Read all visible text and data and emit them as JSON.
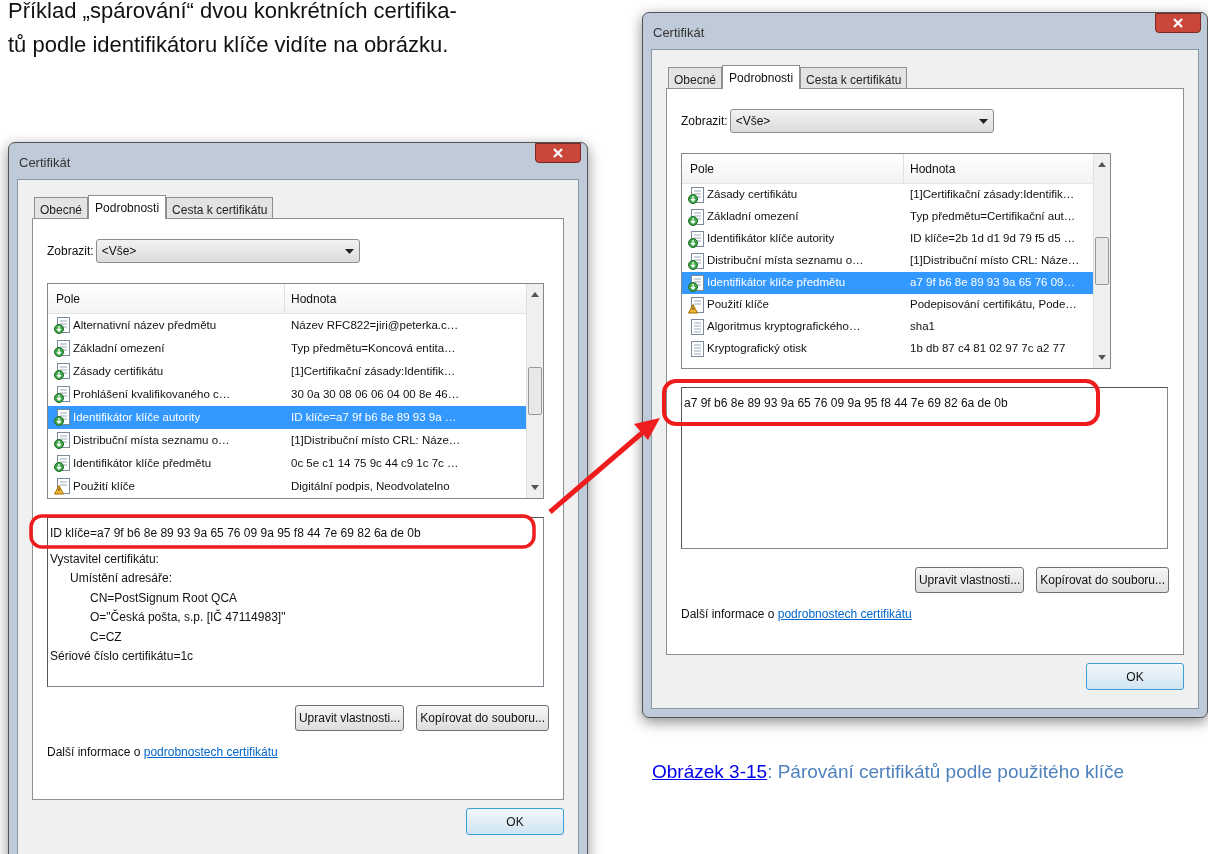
{
  "body_text": "Příklad „spárování“ dvou konkrétních certifika-\ntů podle identifikátoru klíče vidíte na obrázku.",
  "dialogs": [
    {
      "title": "Certifikát",
      "tabs": [
        {
          "label": "Obecné",
          "selected": false
        },
        {
          "label": "Podrobnosti",
          "selected": true
        },
        {
          "label": "Cesta k certifikátu",
          "selected": false
        }
      ],
      "view_selector": {
        "label": "Zobrazit:",
        "value": "<Vše>"
      },
      "columns": [
        "Pole",
        "Hodnota"
      ],
      "fields": [
        {
          "kind": "extension",
          "name": "Alternativní název předmětu",
          "value": "Název RFC822=jiri@peterka.c…",
          "selected": false
        },
        {
          "kind": "extension",
          "name": "Základní omezení",
          "value": "Typ předmětu=Koncová entita…",
          "selected": false
        },
        {
          "kind": "extension",
          "name": "Zásady certifikátu",
          "value": "[1]Certifikační zásady:Identifik…",
          "selected": false
        },
        {
          "kind": "extension",
          "name": "Prohlášení kvalifikovaného c…",
          "value": "30 0a 30 08 06 06 04 00 8e 46…",
          "selected": false
        },
        {
          "kind": "extension",
          "name": "Identifikátor klíče autority",
          "value": "ID klíče=a7 9f b6 8e 89 93 9a …",
          "selected": true
        },
        {
          "kind": "extension",
          "name": "Distribuční místa seznamu o…",
          "value": "[1]Distribuční místo CRL: Náze…",
          "selected": false
        },
        {
          "kind": "extension",
          "name": "Identifikátor klíče předmětu",
          "value": "0c 5e c1 14 75 9c 44 c9 1c 7c …",
          "selected": false
        },
        {
          "kind": "warning",
          "name": "Použití klíče",
          "value": "Digitální podpis, Neodvolatelno",
          "selected": false
        }
      ],
      "details": [
        {
          "text": "ID klíče=a7 9f b6 8e 89 93 9a 65 76 09 9a 95 f8 44 7e 69 82 6a de 0b"
        },
        {
          "text": "Vystavitel certifikátu:",
          "children": [
            {
              "text": "Umístění adresáře:",
              "children": [
                {
                  "text": "CN=PostSignum Root QCA"
                },
                {
                  "text": "O=\"Česká pošta, s.p. [IČ 47114983]\""
                },
                {
                  "text": "C=CZ"
                }
              ]
            }
          ]
        },
        {
          "text": "Sériové číslo certifikátu=1c"
        }
      ],
      "buttons": [
        "Upravit vlastnosti...",
        "Kopírovat do souboru..."
      ],
      "info": {
        "text": "Další informace o ",
        "link": "podrobnostech certifikátu"
      },
      "ok_button": "OK"
    },
    {
      "title": "Certifikát",
      "tabs": [
        {
          "label": "Obecné",
          "selected": false
        },
        {
          "label": "Podrobnosti",
          "selected": true
        },
        {
          "label": "Cesta k certifikátu",
          "selected": false
        }
      ],
      "view_selector": {
        "label": "Zobrazit:",
        "value": "<Vše>"
      },
      "columns": [
        "Pole",
        "Hodnota"
      ],
      "fields": [
        {
          "kind": "extension",
          "name": "Zásady certifikátu",
          "value": "[1]Certifikační zásady:Identifik…",
          "selected": false
        },
        {
          "kind": "extension",
          "name": "Základní omezení",
          "value": "Typ předmětu=Certifikační aut…",
          "selected": false
        },
        {
          "kind": "extension",
          "name": "Identifikátor klíče autority",
          "value": "ID klíče=2b 1d d1 9d 79 f5 d5 …",
          "selected": false
        },
        {
          "kind": "extension",
          "name": "Distribuční místa seznamu o…",
          "value": "[1]Distribuční místo CRL: Náze…",
          "selected": false
        },
        {
          "kind": "extension",
          "name": "Identifikátor klíče předmětu",
          "value": "a7 9f b6 8e 89 93 9a 65 76 09…",
          "selected": true
        },
        {
          "kind": "warning",
          "name": "Použití klíče",
          "value": "Podepisování certifikátu, Pode…",
          "selected": false
        },
        {
          "kind": "plain",
          "name": "Algoritmus kryptografického…",
          "value": "sha1",
          "selected": false
        },
        {
          "kind": "plain",
          "name": "Kryptografický otisk",
          "value": "1b db 87 c4 81 02 97 7c a2 77",
          "selected": false
        }
      ],
      "details": [
        {
          "text": "a7 9f b6 8e 89 93 9a 65 76 09 9a 95 f8 44 7e 69 82 6a de 0b"
        }
      ],
      "buttons": [
        "Upravit vlastnosti...",
        "Kopírovat do souboru..."
      ],
      "info": {
        "text": "Další informace o ",
        "link": "podrobnostech certifikátu"
      },
      "ok_button": "OK"
    }
  ],
  "caption": {
    "link": "Obrázek 3-15",
    "text": ": Párování certifikátů podle použitého klíče"
  }
}
